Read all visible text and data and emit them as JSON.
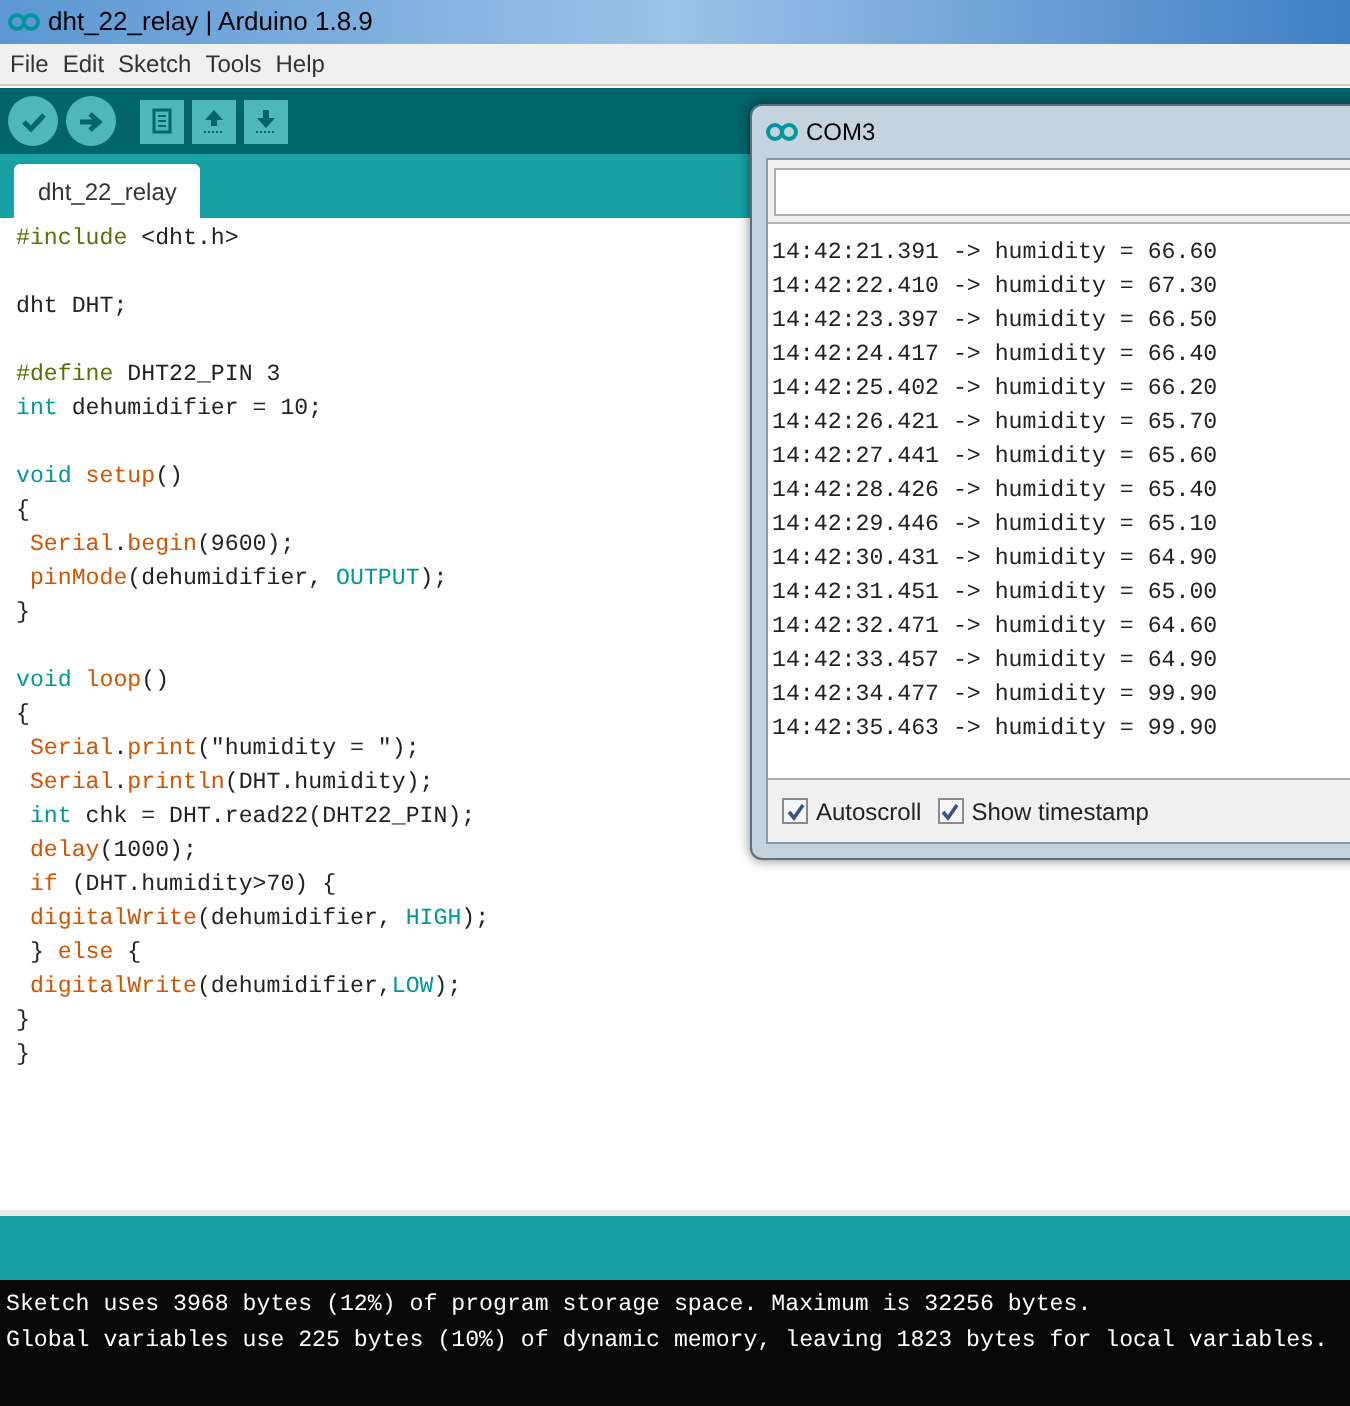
{
  "window": {
    "title": "dht_22_relay | Arduino 1.8.9"
  },
  "menu": [
    "File",
    "Edit",
    "Sketch",
    "Tools",
    "Help"
  ],
  "tabs": [
    {
      "label": "dht_22_relay",
      "selected": true
    }
  ],
  "code_lines": [
    {
      "kind": "code",
      "segments": [
        {
          "kind": "preprocessor",
          "text": "#include"
        },
        {
          "kind": "plain",
          "text": " <dht.h>"
        }
      ]
    },
    {
      "kind": "blank"
    },
    {
      "kind": "code",
      "segments": [
        {
          "kind": "plain",
          "text": "dht DHT;"
        }
      ]
    },
    {
      "kind": "blank"
    },
    {
      "kind": "code",
      "segments": [
        {
          "kind": "preprocessor",
          "text": "#define"
        },
        {
          "kind": "plain",
          "text": " DHT22_PIN 3"
        }
      ]
    },
    {
      "kind": "code",
      "segments": [
        {
          "kind": "type",
          "text": "int"
        },
        {
          "kind": "plain",
          "text": " dehumidifier = 10;"
        }
      ]
    },
    {
      "kind": "blank"
    },
    {
      "kind": "code",
      "segments": [
        {
          "kind": "type",
          "text": "void"
        },
        {
          "kind": "function",
          "text": " setup"
        },
        {
          "kind": "plain",
          "text": "()"
        }
      ]
    },
    {
      "kind": "code",
      "segments": [
        {
          "kind": "plain",
          "text": "{"
        }
      ]
    },
    {
      "kind": "code",
      "segments": [
        {
          "kind": "function",
          "text": " Serial"
        },
        {
          "kind": "plain",
          "text": "."
        },
        {
          "kind": "function",
          "text": "begin"
        },
        {
          "kind": "plain",
          "text": "(9600);"
        }
      ]
    },
    {
      "kind": "code",
      "segments": [
        {
          "kind": "function",
          "text": " pinMode"
        },
        {
          "kind": "plain",
          "text": "(dehumidifier, "
        },
        {
          "kind": "constant",
          "text": "OUTPUT"
        },
        {
          "kind": "plain",
          "text": ");"
        }
      ]
    },
    {
      "kind": "code",
      "segments": [
        {
          "kind": "plain",
          "text": "}"
        }
      ]
    },
    {
      "kind": "blank"
    },
    {
      "kind": "code",
      "segments": [
        {
          "kind": "type",
          "text": "void"
        },
        {
          "kind": "function",
          "text": " loop"
        },
        {
          "kind": "plain",
          "text": "()"
        }
      ]
    },
    {
      "kind": "code",
      "segments": [
        {
          "kind": "plain",
          "text": "{"
        }
      ]
    },
    {
      "kind": "code",
      "segments": [
        {
          "kind": "function",
          "text": " Serial"
        },
        {
          "kind": "plain",
          "text": "."
        },
        {
          "kind": "function",
          "text": "print"
        },
        {
          "kind": "plain",
          "text": "(\"humidity = \");"
        }
      ]
    },
    {
      "kind": "code",
      "segments": [
        {
          "kind": "function",
          "text": " Serial"
        },
        {
          "kind": "plain",
          "text": "."
        },
        {
          "kind": "function",
          "text": "println"
        },
        {
          "kind": "plain",
          "text": "(DHT.humidity);"
        }
      ]
    },
    {
      "kind": "code",
      "segments": [
        {
          "kind": "type",
          "text": " int"
        },
        {
          "kind": "plain",
          "text": " chk = DHT.read22(DHT22_PIN);"
        }
      ]
    },
    {
      "kind": "code",
      "segments": [
        {
          "kind": "function",
          "text": " delay"
        },
        {
          "kind": "plain",
          "text": "(1000);"
        }
      ]
    },
    {
      "kind": "code",
      "segments": [
        {
          "kind": "function",
          "text": " if"
        },
        {
          "kind": "plain",
          "text": " (DHT.humidity>70) {"
        }
      ]
    },
    {
      "kind": "code",
      "segments": [
        {
          "kind": "function",
          "text": " digitalWrite"
        },
        {
          "kind": "plain",
          "text": "(dehumidifier, "
        },
        {
          "kind": "constant",
          "text": "HIGH"
        },
        {
          "kind": "plain",
          "text": ");"
        }
      ]
    },
    {
      "kind": "code",
      "segments": [
        {
          "kind": "plain",
          "text": " } "
        },
        {
          "kind": "function",
          "text": "else"
        },
        {
          "kind": "plain",
          "text": " {"
        }
      ]
    },
    {
      "kind": "code",
      "segments": [
        {
          "kind": "function",
          "text": " digitalWrite"
        },
        {
          "kind": "plain",
          "text": "(dehumidifier,"
        },
        {
          "kind": "constant",
          "text": "LOW"
        },
        {
          "kind": "plain",
          "text": ");"
        }
      ]
    },
    {
      "kind": "code",
      "segments": [
        {
          "kind": "plain",
          "text": "}"
        }
      ]
    },
    {
      "kind": "code",
      "segments": [
        {
          "kind": "plain",
          "text": "}"
        }
      ]
    }
  ],
  "console": [
    "Sketch uses 3968 bytes (12%) of program storage space. Maximum is 32256 bytes.",
    "Global variables use 225 bytes (10%) of dynamic memory, leaving 1823 bytes for local variables."
  ],
  "serial_monitor": {
    "title": "COM3",
    "output": [
      "14:42:21.391 -> humidity = 66.60",
      "14:42:22.410 -> humidity = 67.30",
      "14:42:23.397 -> humidity = 66.50",
      "14:42:24.417 -> humidity = 66.40",
      "14:42:25.402 -> humidity = 66.20",
      "14:42:26.421 -> humidity = 65.70",
      "14:42:27.441 -> humidity = 65.60",
      "14:42:28.426 -> humidity = 65.40",
      "14:42:29.446 -> humidity = 65.10",
      "14:42:30.431 -> humidity = 64.90",
      "14:42:31.451 -> humidity = 65.00",
      "14:42:32.471 -> humidity = 64.60",
      "14:42:33.457 -> humidity = 64.90",
      "14:42:34.477 -> humidity = 99.90",
      "14:42:35.463 -> humidity = 99.90"
    ],
    "options": [
      {
        "label": "Autoscroll",
        "checked": true
      },
      {
        "label": "Show timestamp",
        "checked": true
      }
    ]
  }
}
